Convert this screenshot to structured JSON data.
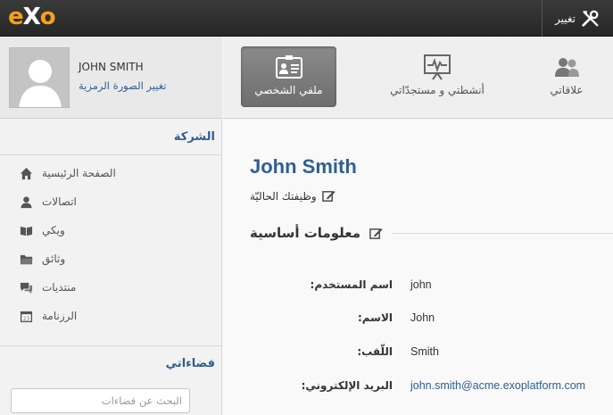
{
  "topbar": {
    "logo_e": "e",
    "logo_x": "X",
    "logo_o": "o",
    "edit_label": "تغيير",
    "edit_icon": "tools-icon"
  },
  "sidebar": {
    "user_name": "JOHN SMITH",
    "change_avatar": "تغيير الصورة الرمزية",
    "company_title": "الشركة",
    "items": [
      {
        "label": "الصفحة الرئيسية",
        "icon": "home-icon"
      },
      {
        "label": "اتصالات",
        "icon": "person-icon"
      },
      {
        "label": "ويكي",
        "icon": "book-icon"
      },
      {
        "label": "وثائق",
        "icon": "folder-icon"
      },
      {
        "label": "منتديات",
        "icon": "chat-icon"
      },
      {
        "label": "الرزنامة",
        "icon": "calendar-icon"
      }
    ],
    "spaces_title": "فضاءاتي",
    "search_placeholder": "البحث عن فضاءات"
  },
  "tabs": [
    {
      "label": "ملفي الشخصي",
      "icon": "profile-card-icon",
      "active": true
    },
    {
      "label": "أنشطتي و مستجدّاتي",
      "icon": "activity-icon",
      "active": false
    },
    {
      "label": "علاقاتي",
      "icon": "people-icon",
      "active": false
    }
  ],
  "profile": {
    "display_name": "John Smith",
    "job_label": "وظيفتك الحاليّة",
    "basic_info_title": "معلومات أساسية",
    "fields": [
      {
        "label": "اسم المستخدم:",
        "value": "john"
      },
      {
        "label": "الاسم:",
        "value": "John"
      },
      {
        "label": "اللّقب:",
        "value": "Smith"
      },
      {
        "label": "البريد الإلكتروني:",
        "value": "john.smith@acme.exoplatform.com"
      }
    ]
  },
  "colors": {
    "accent": "#2f5e92",
    "logo_orange": "#f6a01a",
    "topbar": "#2b2b2b"
  }
}
